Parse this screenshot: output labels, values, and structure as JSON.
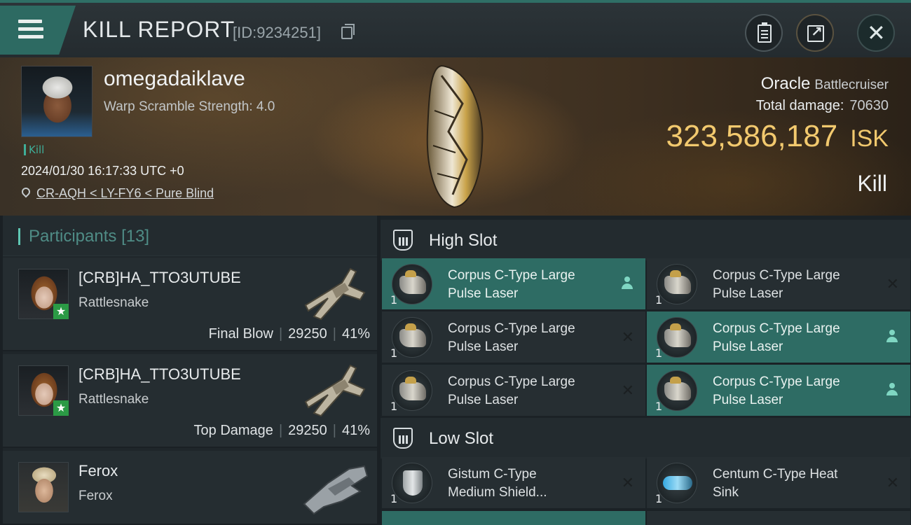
{
  "header": {
    "title": "KILL REPORT",
    "report_id": "[ID:9234251]",
    "icons": [
      "menu-icon",
      "copy-icon",
      "clipboard-icon",
      "share-icon",
      "close-icon"
    ]
  },
  "victim": {
    "pilot_name": "omegadaiklave",
    "warp_scramble": "Warp Scramble Strength: 4.0",
    "tag": "Kill",
    "datetime": "2024/01/30 16:17:33 UTC +0",
    "location": "CR-AQH < LY-FY6 < Pure Blind",
    "ship_name": "Oracle",
    "ship_class": "Battlecruiser",
    "total_damage_label": "Total damage:",
    "total_damage": "70630",
    "isk_value": "323,586,187",
    "isk_unit": "ISK",
    "result": "Kill"
  },
  "participants": {
    "title": "Participants",
    "count": "[13]",
    "rows": [
      {
        "name": "[CRB]HA_TTO3UTUBE",
        "ship": "Rattlesnake",
        "role": "Final Blow",
        "damage": "29250",
        "percent": "41%"
      },
      {
        "name": "[CRB]HA_TTO3UTUBE",
        "ship": "Rattlesnake",
        "role": "Top Damage",
        "damage": "29250",
        "percent": "41%"
      },
      {
        "name": "Ferox",
        "ship": "Ferox",
        "role": "",
        "damage": "",
        "percent": ""
      }
    ]
  },
  "slots": {
    "high": {
      "title": "High Slot",
      "items": [
        {
          "name_line1": "Corpus C-Type Large",
          "name_line2": "Pulse Laser",
          "qty": "1",
          "state": "active"
        },
        {
          "name_line1": "Corpus C-Type Large",
          "name_line2": "Pulse Laser",
          "qty": "1",
          "state": "destroyed"
        },
        {
          "name_line1": "Corpus C-Type Large",
          "name_line2": "Pulse Laser",
          "qty": "1",
          "state": "destroyed"
        },
        {
          "name_line1": "Corpus C-Type Large",
          "name_line2": "Pulse Laser",
          "qty": "1",
          "state": "active"
        },
        {
          "name_line1": "Corpus C-Type Large",
          "name_line2": "Pulse Laser",
          "qty": "1",
          "state": "destroyed"
        },
        {
          "name_line1": "Corpus C-Type Large",
          "name_line2": "Pulse Laser",
          "qty": "1",
          "state": "active"
        }
      ]
    },
    "low": {
      "title": "Low Slot",
      "items": [
        {
          "name_line1": "Gistum C-Type",
          "name_line2": "Medium Shield...",
          "qty": "1",
          "state": "destroyed"
        },
        {
          "name_line1": "Centum C-Type Heat",
          "name_line2": "Sink",
          "qty": "1",
          "state": "destroyed"
        }
      ]
    }
  },
  "colors": {
    "accent_teal": "#2e6c64",
    "isk_gold": "#f2c96e",
    "kill_green": "#3fae98"
  }
}
